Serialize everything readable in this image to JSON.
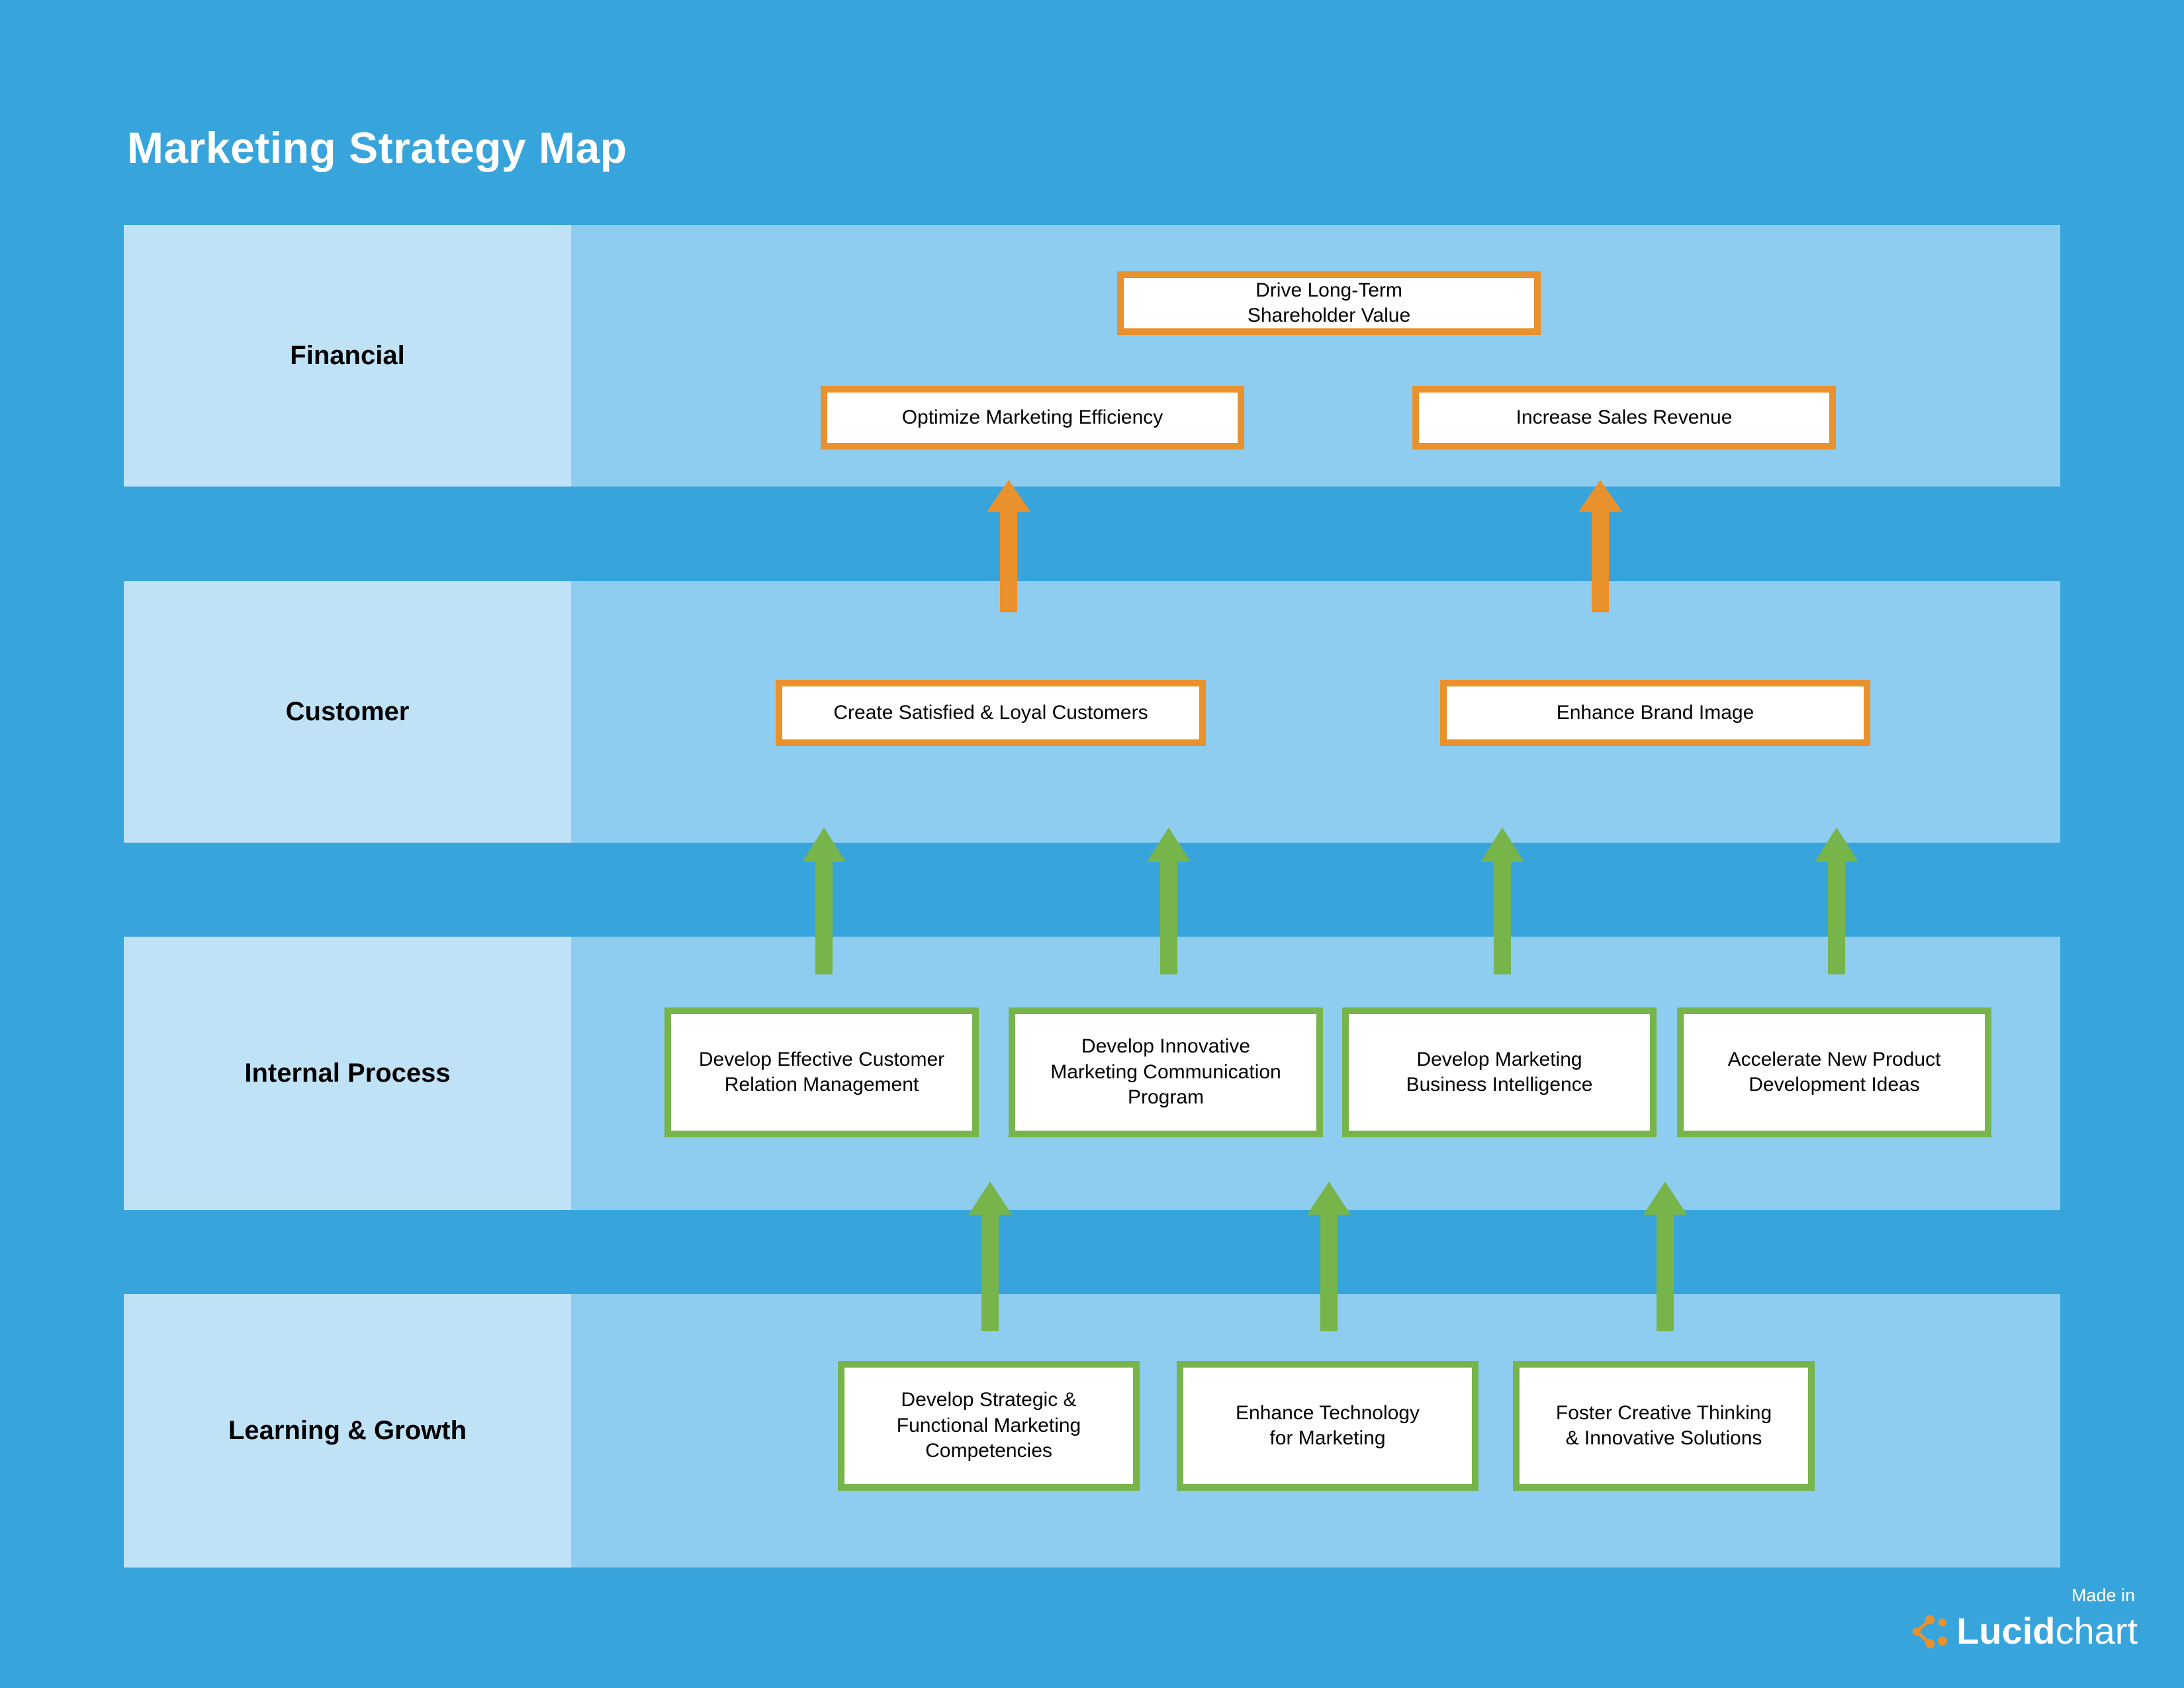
{
  "page": {
    "title": "Marketing Strategy Map",
    "background_color": "#38a4dc",
    "band_color": "#8ecdef",
    "label_cell_color": "#bfe2f7",
    "orange": "#e8912d",
    "green": "#77b44a"
  },
  "rows": [
    {
      "label": "Financial"
    },
    {
      "label": "Customer"
    },
    {
      "label": "Internal Process"
    },
    {
      "label": "Learning & Growth"
    }
  ],
  "objectives": {
    "financial": [
      {
        "text": "Drive Long-Term\nShareholder Value",
        "color": "orange"
      },
      {
        "text": "Optimize Marketing Efficiency",
        "color": "orange"
      },
      {
        "text": "Increase Sales Revenue",
        "color": "orange"
      }
    ],
    "customer": [
      {
        "text": "Create Satisfied & Loyal Customers",
        "color": "orange"
      },
      {
        "text": "Enhance Brand Image",
        "color": "orange"
      }
    ],
    "internal_process": [
      {
        "text": "Develop Effective Customer\nRelation Management",
        "color": "green"
      },
      {
        "text": "Develop Innovative\nMarketing Communication\nProgram",
        "color": "green"
      },
      {
        "text": "Develop Marketing\nBusiness Intelligence",
        "color": "green"
      },
      {
        "text": "Accelerate New Product\nDevelopment Ideas",
        "color": "green"
      }
    ],
    "learning_growth": [
      {
        "text": "Develop Strategic &\nFunctional Marketing\nCompetencies",
        "color": "green"
      },
      {
        "text": "Enhance Technology\nfor Marketing",
        "color": "green"
      },
      {
        "text": "Foster Creative Thinking\n& Innovative Solutions",
        "color": "green"
      }
    ]
  },
  "footer": {
    "made_in": "Made in",
    "brand_bold": "Lucid",
    "brand_light": "chart",
    "mark_color": "#e8912d"
  }
}
